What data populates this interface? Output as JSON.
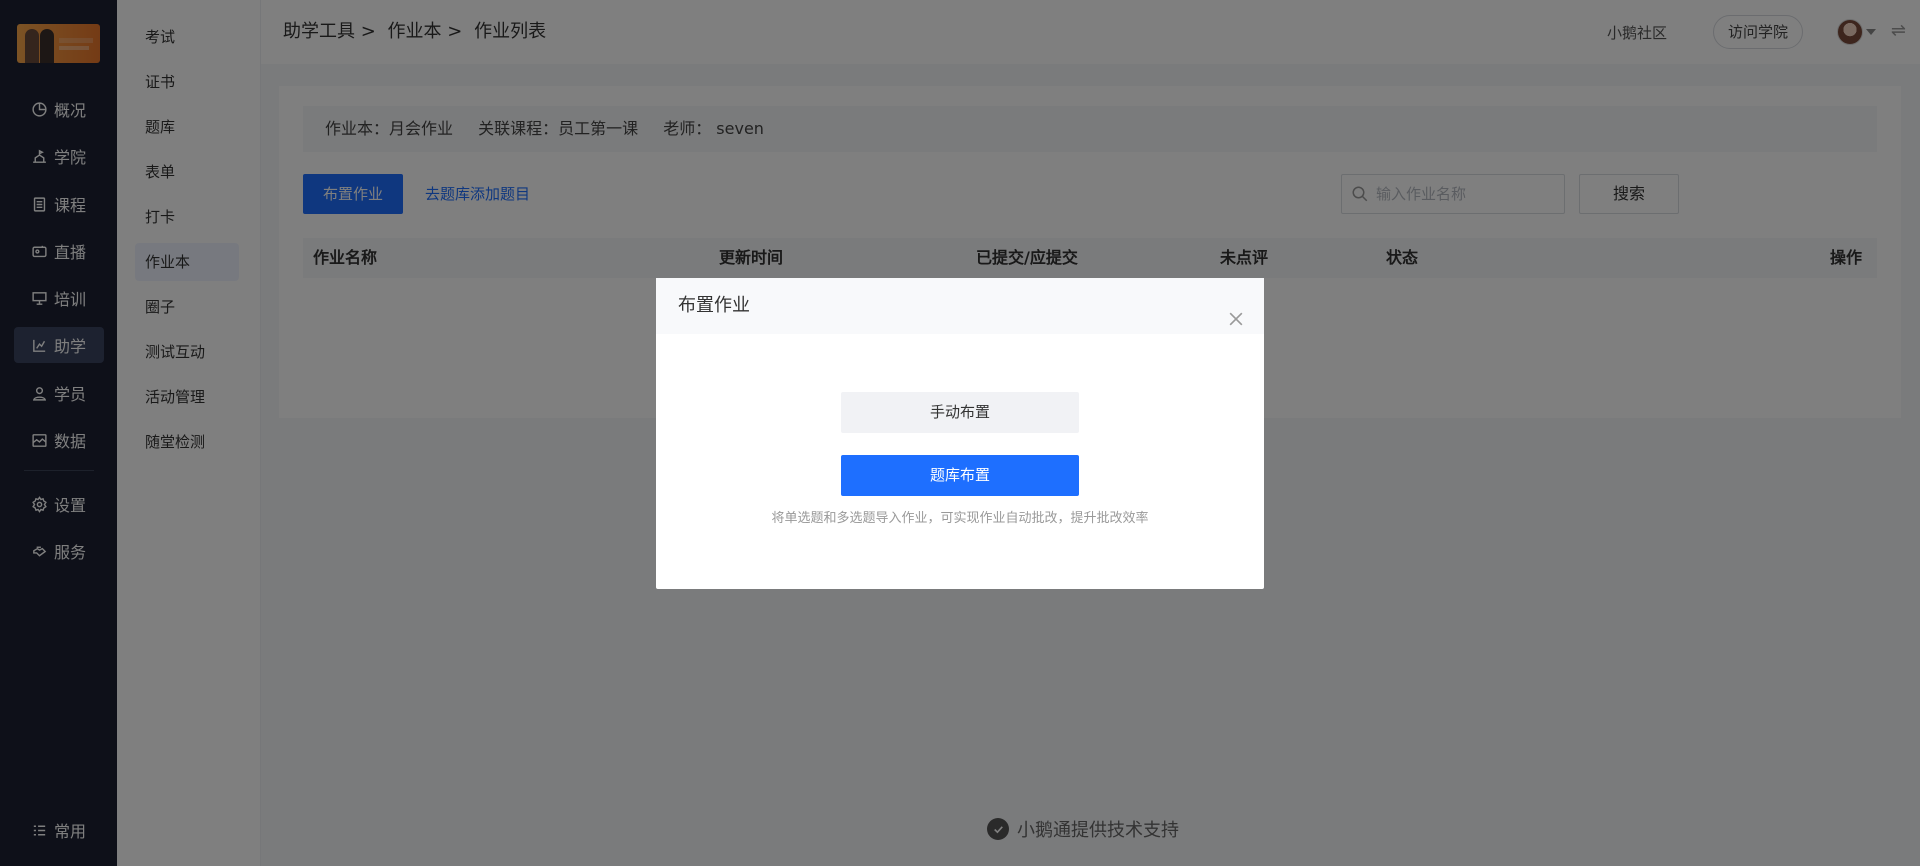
{
  "nav": {
    "items": [
      {
        "label": "概况",
        "icon": "pie-chart-icon"
      },
      {
        "label": "学院",
        "icon": "academy-icon"
      },
      {
        "label": "课程",
        "icon": "document-icon"
      },
      {
        "label": "直播",
        "icon": "camera-icon"
      },
      {
        "label": "培训",
        "icon": "presentation-icon"
      },
      {
        "label": "助学",
        "icon": "ruler-chart-icon",
        "active": true
      },
      {
        "label": "学员",
        "icon": "user-icon"
      },
      {
        "label": "数据",
        "icon": "image-data-icon"
      },
      {
        "label": "设置",
        "icon": "gear-icon"
      },
      {
        "label": "服务",
        "icon": "handshake-icon"
      },
      {
        "label": "常用",
        "icon": "list-icon"
      }
    ]
  },
  "submenu": {
    "items": [
      "考试",
      "证书",
      "题库",
      "表单",
      "打卡",
      "作业本",
      "圈子",
      "测试互动",
      "活动管理",
      "随堂检测"
    ],
    "active": "作业本"
  },
  "header": {
    "crumbs": [
      "助学工具 >",
      "作业本 >",
      "作业列表"
    ],
    "community_link": "小鹅社区",
    "visit_button": "访问学院"
  },
  "info": {
    "book": "作业本：月会作业",
    "course": "关联课程：员工第一课",
    "teacher": "老师： seven"
  },
  "toolbar": {
    "assign_button": "布置作业",
    "add_from_bank_link": "去题库添加题目",
    "search_placeholder": "输入作业名称",
    "search_button": "搜索"
  },
  "table": {
    "columns": [
      "作业名称",
      "更新时间",
      "已提交/应提交",
      "未点评",
      "状态",
      "操作"
    ]
  },
  "footer": {
    "text": "小鹅通提供技术支持"
  },
  "modal": {
    "title": "布置作业",
    "manual_option": "手动布置",
    "bank_option": "题库布置",
    "hint": "将单选题和多选题导入作业，可实现作业自动批改，提升批改效率"
  },
  "colors": {
    "accent": "#1e6fff",
    "nav_bg": "#1c2133",
    "overlay": "rgba(0,0,0,0.5)"
  }
}
